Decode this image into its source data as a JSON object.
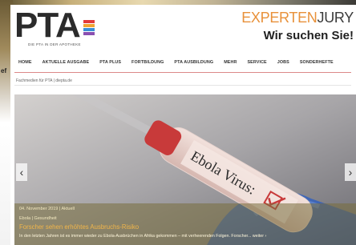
{
  "header": {
    "logo_text": "PTA",
    "logo_tagline": "DIE PTA IN DER APOTHEKE",
    "logo_bar_colors": [
      "#e23a3a",
      "#f1a431",
      "#3a8fd6",
      "#8a4fb0"
    ]
  },
  "ad": {
    "line1_part1": "EXPERTEN",
    "line1_part2": "JURY",
    "line2": "Wir suchen Sie!"
  },
  "nav": {
    "items": [
      "HOME",
      "AKTUELLE AUSGABE",
      "PTA PLUS",
      "FORTBILDUNG",
      "PTA AUSBILDUNG",
      "MEHR",
      "SERVICE",
      "JOBS",
      "SONDERHEFTE"
    ]
  },
  "breadcrumb": "Fachmedien für PTA | diepta.de",
  "hero": {
    "tube_label": "Ebola Virus:",
    "prev_icon": "chevron-left-icon",
    "next_icon": "chevron-right-icon",
    "prev_glyph": "‹",
    "next_glyph": "›",
    "date": "04. November 2019 | Aktuell",
    "category": "Ebola | Gesundheit",
    "title": "Forscher sehen erhöhtes Ausbruchs-Risiko",
    "teaser": "In den letzten Jahren ist es immer wieder zu Ebola-Ausbrüchen in Afrika gekommen – mit verheerenden Folgen. Forscher... weiter ›"
  },
  "background": {
    "left_text": "ef"
  },
  "colors": {
    "accent_orange": "#e8913a",
    "nav_rule": "#c43a3a",
    "caption_title": "#f2b64a"
  }
}
